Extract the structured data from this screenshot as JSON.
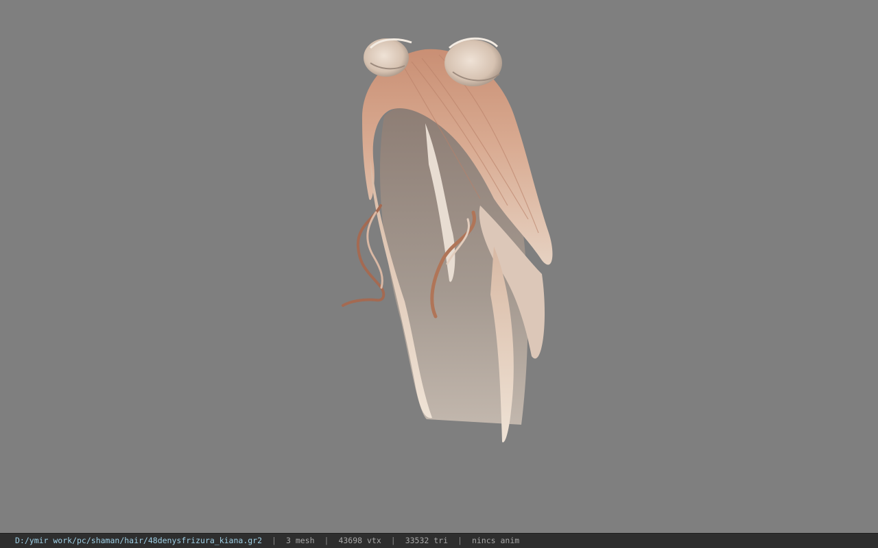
{
  "viewer": {
    "background_color": "#7f7f7f",
    "model_icon": "hair-model"
  },
  "status": {
    "file_path": "D:/ymir work/pc/shaman/hair/48denysfrizura_kiana.gr2",
    "separator": "|",
    "mesh": "3 mesh",
    "vertices": "43698 vtx",
    "triangles": "33532 tri",
    "anim": "nincs anim"
  }
}
